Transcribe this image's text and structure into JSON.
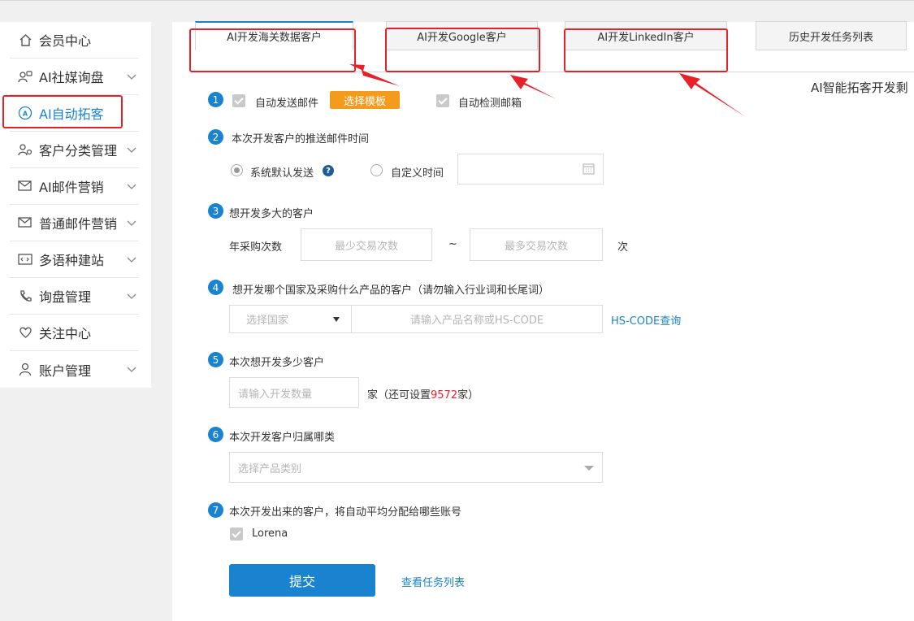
{
  "sidebar": {
    "items": [
      {
        "label": "会员中心",
        "icon": "home-icon",
        "has_chevron": false
      },
      {
        "label": "AI社媒询盘",
        "icon": "social-icon",
        "has_chevron": true
      },
      {
        "label": "AI自动拓客",
        "icon": "ai-icon",
        "has_chevron": false,
        "active": true
      },
      {
        "label": "客户分类管理",
        "icon": "users-icon",
        "has_chevron": true
      },
      {
        "label": "AI邮件营销",
        "icon": "mail-send-icon",
        "has_chevron": true
      },
      {
        "label": "普通邮件营销",
        "icon": "mail-icon",
        "has_chevron": true
      },
      {
        "label": "多语种建站",
        "icon": "code-icon",
        "has_chevron": true
      },
      {
        "label": "询盘管理",
        "icon": "phone-icon",
        "has_chevron": true
      },
      {
        "label": "关注中心",
        "icon": "heart-icon",
        "has_chevron": false
      },
      {
        "label": "账户管理",
        "icon": "user-icon",
        "has_chevron": true
      }
    ]
  },
  "tabs": [
    {
      "label": "AI开发海关数据客户",
      "active": true
    },
    {
      "label": "AI开发Google客户",
      "active": false
    },
    {
      "label": "AI开发LinkedIn客户",
      "active": false
    },
    {
      "label": "历史开发任务列表",
      "active": false
    }
  ],
  "right_text": "AI智能拓客开发剩",
  "form": {
    "step1": {
      "num": "1",
      "auto_send_label": "自动发送邮件",
      "choose_template": "选择模板",
      "auto_check_label": "自动检测邮箱"
    },
    "step2": {
      "num": "2",
      "title": "本次开发客户的推送邮件时间",
      "default_send": "系统默认发送",
      "help": "?",
      "custom_time": "自定义时间"
    },
    "step3": {
      "num": "3",
      "title": "想开发多大的客户",
      "purchase_label": "年采购次数",
      "min_placeholder": "最少交易次数",
      "tilde": "~",
      "max_placeholder": "最多交易次数",
      "unit": "次"
    },
    "step4": {
      "num": "4",
      "title": "想开发哪个国家及采购什么产品的客户（请勿输入行业词和长尾词）",
      "country_placeholder": "选择国家",
      "product_placeholder": "请输入产品名称或HS-CODE",
      "hs_link": "HS-CODE查询"
    },
    "step5": {
      "num": "5",
      "title": "本次想开发多少客户",
      "count_placeholder": "请输入开发数量",
      "suffix_pre": "家（还可设置",
      "remaining": "9572",
      "suffix_post": "家）"
    },
    "step6": {
      "num": "6",
      "title": "本次开发客户归属哪类",
      "category_placeholder": "选择产品类别"
    },
    "step7": {
      "num": "7",
      "title": "本次开发出来的客户，将自动平均分配给哪些账号",
      "account": "Lorena"
    },
    "submit": "提交",
    "view_tasks": "查看任务列表"
  },
  "colors": {
    "accent": "#1a83d0",
    "orange": "#f39b1c",
    "annotation_red": "#e8202a"
  }
}
